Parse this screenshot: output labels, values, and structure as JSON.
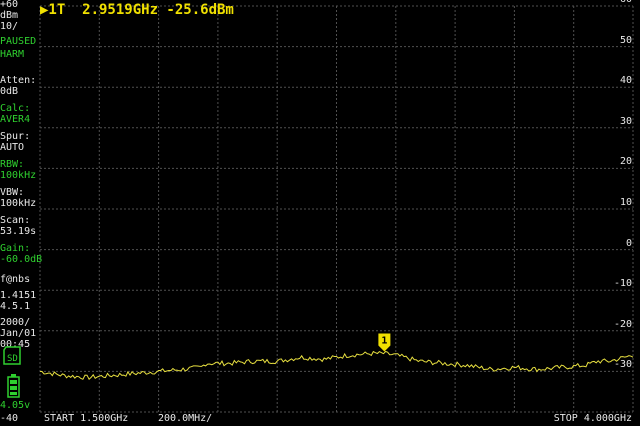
{
  "sidebar": {
    "ref_level": "+60",
    "ref_unit": "dBm",
    "scale": "10/",
    "status_paused": "PAUSED",
    "status_harm": "HARM",
    "atten_label": "Atten:",
    "atten_value": "0dB",
    "calc_label": "Calc:",
    "calc_value": "AVER4",
    "spur_label": "Spur:",
    "spur_value": "AUTO",
    "rbw_label": "RBW:",
    "rbw_value": "100kHz",
    "vbw_label": "VBW:",
    "vbw_value": "100kHz",
    "scan_label": "Scan:",
    "scan_value": "53.19s",
    "gain_label": "Gain:",
    "gain_value": "-60.0dB",
    "fw_label": "f@nbs",
    "fw_version_1": "1.4151",
    "fw_version_2": "4.5.1",
    "date_1": "2000/",
    "date_2": "Jan/01",
    "time": "00:45",
    "sd_icon_label": "SD",
    "battery_voltage": "4.05v",
    "bottom_level": "-40"
  },
  "marker": {
    "readout": "▶1T  2.9519GHz -25.6dBm",
    "label": "1",
    "freq_ghz": 2.9519,
    "level_dbm": -25.6
  },
  "footer": {
    "start": "START 1.500GHz",
    "per_div": "200.0MHz/",
    "stop": "STOP 4.000GHz"
  },
  "colors": {
    "trace": "#e8e040",
    "grid": "#505050",
    "marker": "#f0e000",
    "accent_green": "#2fd02f",
    "text": "#e8e8e8"
  },
  "chart_data": {
    "type": "line",
    "xlim": [
      1.5,
      4.0
    ],
    "ylim": [
      -40,
      60
    ],
    "x_unit": "GHz",
    "y_unit": "dBm",
    "y_ticks": [
      60,
      50,
      40,
      30,
      20,
      10,
      0,
      -10,
      -20,
      -30
    ],
    "grid": true,
    "series": [
      {
        "x": [
          1.5,
          1.6,
          1.7,
          1.8,
          1.9,
          2.0,
          2.1,
          2.18,
          2.2,
          2.3,
          2.4,
          2.5,
          2.6,
          2.7,
          2.8,
          2.85,
          2.9,
          2.95,
          3.0,
          3.1,
          3.2,
          3.3,
          3.4,
          3.5,
          3.6,
          3.7,
          3.8,
          3.85,
          3.9,
          4.0
        ],
        "y": [
          -30.0,
          -31.0,
          -31.5,
          -31.0,
          -30.5,
          -30.0,
          -29.5,
          -29.0,
          -28.0,
          -28.0,
          -27.5,
          -27.5,
          -26.5,
          -27.0,
          -26.0,
          -25.8,
          -25.6,
          -25.6,
          -26.0,
          -27.5,
          -28.0,
          -28.5,
          -29.5,
          -29.0,
          -29.5,
          -29.0,
          -28.5,
          -27.5,
          -27.5,
          -26.0
        ]
      }
    ]
  }
}
